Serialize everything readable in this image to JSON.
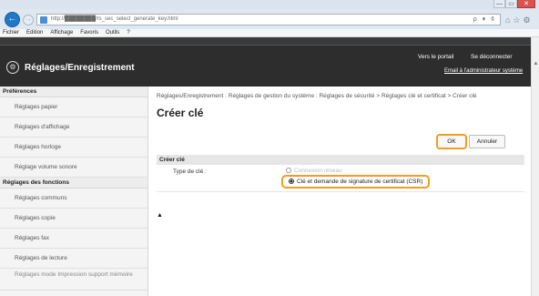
{
  "browser": {
    "url": "http://████████/rs_sec_select_generate_key.html",
    "minimize": "—",
    "maximize": "▭",
    "close": "✕",
    "url_icons": "ρ ▾ ¢",
    "menu": [
      "Fichier",
      "Edition",
      "Affichage",
      "Favoris",
      "Outils",
      "?"
    ]
  },
  "header": {
    "title": "Réglages/Enregistrement",
    "portal_link": "Vers le portail",
    "logout_link": "Se déconnecter",
    "mail_link": "Email à l'administrateur système"
  },
  "sidebar": {
    "section1": "Préférences",
    "prefs": [
      "Réglages papier",
      "Réglages d'affichage",
      "Réglages horloge",
      "Réglage volume sonore"
    ],
    "section2": "Réglages des fonctions",
    "functions": [
      "Réglages communs",
      "Réglages copie",
      "Réglages fax",
      "Réglages de lecture",
      "Réglages mode Impression support mémoire"
    ]
  },
  "main": {
    "breadcrumb": "Réglages/Enregistrement : Réglages de gestion du système : Réglages de sécurité > Réglages clé et certificat > Créer clé",
    "title": "Créer clé",
    "ok_label": "OK",
    "cancel_label": "Annuler",
    "section_title": "Créer clé",
    "field_label": "Type de clé :",
    "option1": "Connexion réseau",
    "option2": "Clé et demande de signature de certificat (CSR)",
    "selected_option": "option2",
    "top_arrow": "▲"
  }
}
